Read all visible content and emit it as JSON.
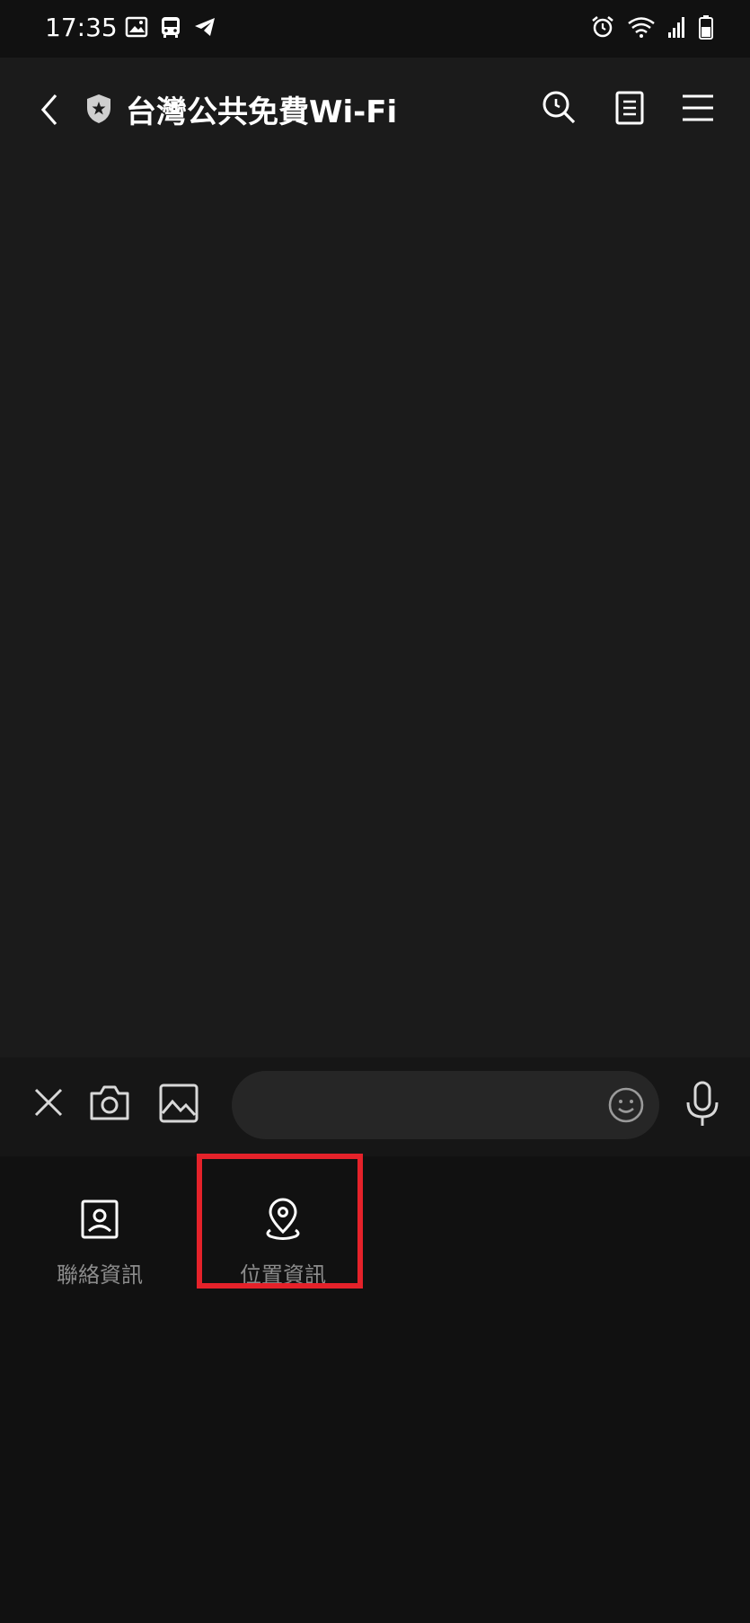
{
  "status_bar": {
    "time": "17:35",
    "left_icons": [
      "image-icon",
      "bus-icon",
      "telegram-icon"
    ],
    "right_icons": [
      "alarm-icon",
      "wifi-icon",
      "signal-icon",
      "battery-icon"
    ]
  },
  "header": {
    "title": "台灣公共免費Wi-Fi",
    "back_icon": "chevron-left-icon",
    "badge_icon": "shield-star-icon",
    "actions": [
      "search-icon",
      "notes-icon",
      "menu-icon"
    ]
  },
  "input_bar": {
    "close_icon": "close-icon",
    "camera_icon": "camera-icon",
    "gallery_icon": "image-icon",
    "message_value": "",
    "emoji_icon": "emoji-icon",
    "mic_icon": "mic-icon"
  },
  "menu": {
    "items": [
      {
        "label": "聯絡資訊",
        "icon": "contact-icon"
      },
      {
        "label": "位置資訊",
        "icon": "location-pin-icon"
      }
    ]
  },
  "colors": {
    "background": "#111111",
    "header_bg": "#1b1b1b",
    "input_bg": "#262626",
    "label_gray": "#8c8c8c",
    "highlight_red": "#e5222a"
  }
}
